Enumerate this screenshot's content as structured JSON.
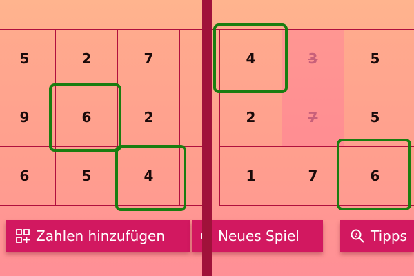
{
  "left_board": {
    "rows": [
      [
        "5",
        "2",
        "7",
        ""
      ],
      [
        "9",
        "6",
        "2",
        ""
      ],
      [
        "6",
        "5",
        "4",
        ""
      ]
    ]
  },
  "right_board": {
    "rows": [
      [
        "4",
        "3",
        "5",
        ""
      ],
      [
        "2",
        "7",
        "5",
        ""
      ],
      [
        "1",
        "7",
        "6",
        ""
      ]
    ]
  },
  "buttons": {
    "add_numbers": "Zahlen hinzufügen",
    "new_game": "Neues Spiel",
    "hint": "Tipps"
  },
  "colors": {
    "grid_line": "#b0103e",
    "highlight": "#1a7d10",
    "button": "#d21860",
    "divider": "#a0123a"
  },
  "icons": {
    "add_numbers": "add-grid-icon",
    "new_game": "refresh-icon",
    "hint": "search-hint-icon"
  }
}
